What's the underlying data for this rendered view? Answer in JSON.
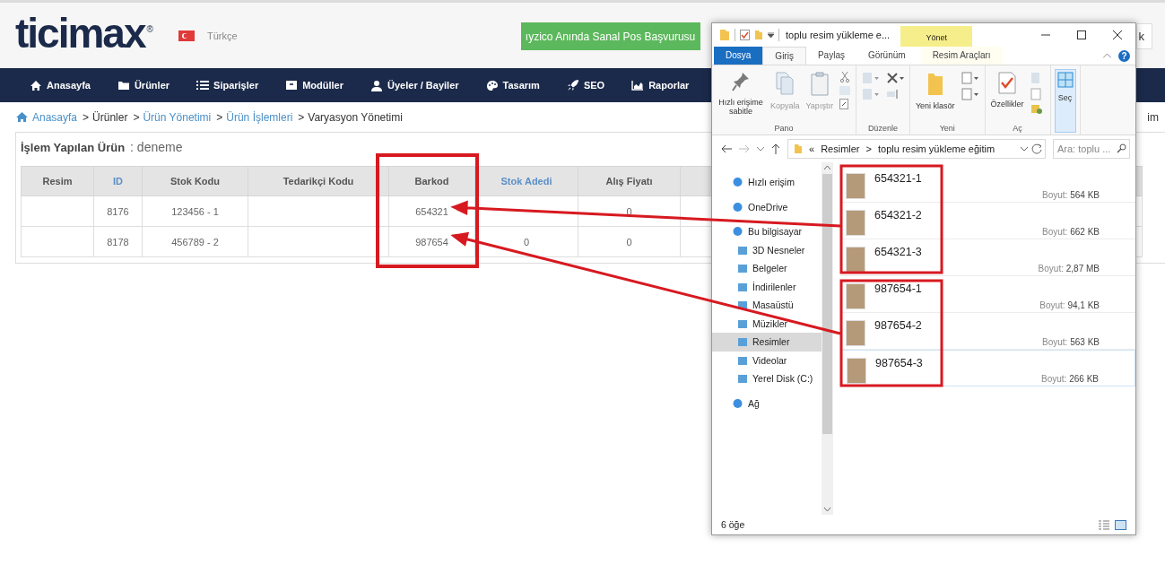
{
  "header": {
    "logo": "ticimax",
    "logo_mark": "®",
    "language": "Türkçe",
    "promo_button": "ıyzico Anında Sanal Pos Başvurusu",
    "cut_button": "k"
  },
  "nav": [
    {
      "label": "Anasayfa"
    },
    {
      "label": "Ürünler"
    },
    {
      "label": "Siparişler"
    },
    {
      "label": "Modüller"
    },
    {
      "label": "Üyeler / Bayiler"
    },
    {
      "label": "Tasarım"
    },
    {
      "label": "SEO"
    },
    {
      "label": "Raporlar"
    }
  ],
  "breadcrumb": {
    "separator": ">",
    "items": [
      {
        "label": "Anasayfa",
        "link": true
      },
      {
        "label": "Ürünler",
        "link": false
      },
      {
        "label": "Ürün Yönetimi",
        "link": true
      },
      {
        "label": "Ürün İşlemleri",
        "link": true
      },
      {
        "label": "Varyasyon Yönetimi",
        "link": false
      }
    ],
    "cut_text": "im"
  },
  "product": {
    "label": "İşlem Yapılan Ürün",
    "value": ": deneme"
  },
  "table": {
    "columns": [
      {
        "label": "Resim",
        "sortable": false
      },
      {
        "label": "ID",
        "sortable": true
      },
      {
        "label": "Stok Kodu",
        "sortable": false
      },
      {
        "label": "Tedarikçi Kodu",
        "sortable": false
      },
      {
        "label": "Barkod",
        "sortable": false
      },
      {
        "label": "Stok Adedi",
        "sortable": true
      },
      {
        "label": "Alış Fiyatı",
        "sortable": false
      }
    ],
    "rows": [
      {
        "cells": [
          null,
          "8176",
          "123456 - 1",
          null,
          "654321",
          null,
          "0"
        ]
      },
      {
        "cells": [
          null,
          "8178",
          "456789 - 2",
          null,
          "987654",
          "0",
          "0"
        ]
      }
    ]
  },
  "explorer": {
    "title": "toplu resim yükleme e...",
    "context_tab": "Yönet",
    "help": "?",
    "tabs": [
      {
        "label": "Dosya",
        "kind": "file",
        "selected": false
      },
      {
        "label": "Giriş",
        "kind": "tab",
        "selected": true
      },
      {
        "label": "Paylaş",
        "kind": "tab",
        "selected": false
      },
      {
        "label": "Görünüm",
        "kind": "tab",
        "selected": false
      },
      {
        "label": "Resim Araçları",
        "kind": "context",
        "selected": false
      }
    ],
    "ribbon": [
      {
        "label": "Pano",
        "buttons": [
          {
            "label": "Hızlı erişime sabitle",
            "disabled": false
          },
          {
            "label": "Kopyala",
            "disabled": true
          },
          {
            "label": "Yapıştır",
            "disabled": true
          }
        ]
      },
      {
        "label": "Düzenle"
      },
      {
        "label": "Yeni",
        "buttons": [
          {
            "label": "Yeni klasör",
            "disabled": false
          }
        ]
      },
      {
        "label": "Aç",
        "buttons": [
          {
            "label": "Özellikler",
            "disabled": false
          }
        ]
      },
      {
        "buttons": [
          {
            "label": "Seç",
            "disabled": false
          }
        ]
      }
    ],
    "address": {
      "prefix": "«",
      "separator": ">",
      "path": [
        "Resimler",
        "toplu resim yükleme eğitim"
      ]
    },
    "search": {
      "placeholder": "Ara: toplu ..."
    },
    "nav_pane": [
      {
        "label": "Hızlı erişim",
        "selected": false
      },
      {
        "label": "OneDrive",
        "selected": false
      },
      {
        "label": "Bu bilgisayar",
        "selected": false,
        "children": [
          {
            "label": "3D Nesneler",
            "selected": false
          },
          {
            "label": "Belgeler",
            "selected": false
          },
          {
            "label": "İndirilenler",
            "selected": false
          },
          {
            "label": "Masaüstü",
            "selected": false
          },
          {
            "label": "Müzikler",
            "selected": false
          },
          {
            "label": "Resimler",
            "selected": true
          },
          {
            "label": "Videolar",
            "selected": false
          },
          {
            "label": "Yerel Disk (C:)",
            "selected": false
          }
        ]
      },
      {
        "label": "Ağ",
        "selected": false
      }
    ],
    "files": [
      {
        "name": "654321-1",
        "size_label": "Boyut:",
        "size": "564 KB",
        "selected": false
      },
      {
        "name": "654321-2",
        "size_label": "Boyut:",
        "size": "662 KB",
        "selected": false
      },
      {
        "name": "654321-3",
        "size_label": "Boyut:",
        "size": "2,87 MB",
        "selected": false
      },
      {
        "name": "987654-1",
        "size_label": "Boyut:",
        "size": "94,1 KB",
        "selected": false
      },
      {
        "name": "987654-2",
        "size_label": "Boyut:",
        "size": "563 KB",
        "selected": false
      },
      {
        "name": "987654-3",
        "size_label": "Boyut:",
        "size": "266 KB",
        "selected": true
      }
    ],
    "status": "6 öğe"
  }
}
